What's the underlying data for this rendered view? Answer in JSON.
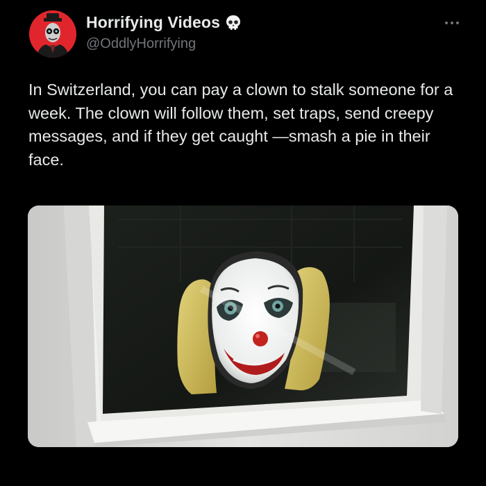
{
  "post": {
    "author": {
      "display_name": "Horrifying Videos",
      "handle": "@OddlyHorrifying",
      "badge_icon": "skull-icon",
      "avatar_color": "#e0262c"
    },
    "text": "In Switzerland, you can pay a clown to stalk someone for a week. The clown will follow them, set traps, send creepy messages, and if they get caught —smash a pie in their face.",
    "media": {
      "type": "photo",
      "subject": "clown-face-at-window"
    },
    "menu_icon": "more-options-icon"
  },
  "colors": {
    "background": "#000000",
    "primary_text": "#e7e9ea",
    "secondary_text": "#71767b"
  }
}
